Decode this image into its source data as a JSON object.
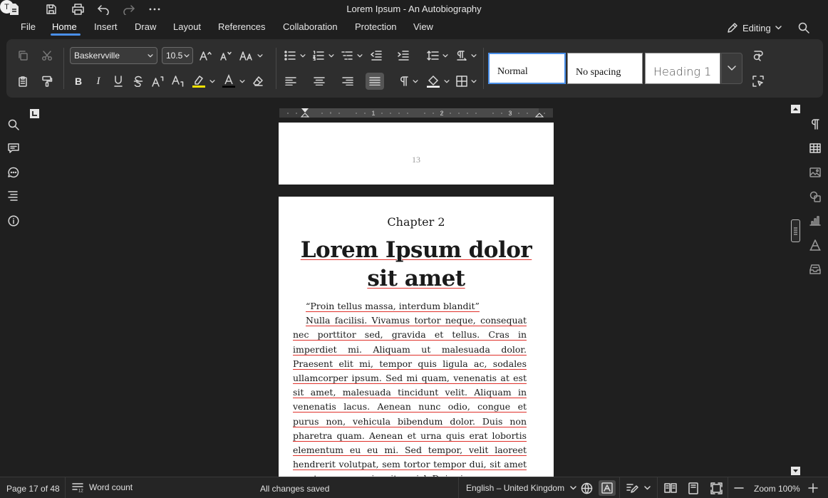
{
  "window": {
    "title": "Lorem Ipsum - An Autobiography",
    "user_initial": "T"
  },
  "menu": {
    "file": "File",
    "home": "Home",
    "insert": "Insert",
    "draw": "Draw",
    "layout": "Layout",
    "references": "References",
    "collaboration": "Collaboration",
    "protection": "Protection",
    "view": "View",
    "mode": "Editing"
  },
  "ribbon": {
    "font_family": "Baskervville",
    "font_size": "10.5",
    "styles": {
      "normal": "Normal",
      "no_spacing": "No spacing",
      "heading1": "Heading 1"
    },
    "colors": {
      "highlight": "#f5e100",
      "font_color": "#000000"
    }
  },
  "document": {
    "prev_page_number": "13",
    "chapter": "Chapter 2",
    "heading": "Lorem Ipsum dolor sit amet",
    "quote": "“Proin tellus massa, interdum blandit”",
    "paragraph": "Nulla facilisi. Vivamus tortor neque, consequat nec porttitor sed, gravida et tellus. Cras in imperdiet mi. Aliquam ut malesuada dolor. Praesent elit mi, tempor quis ligula ac, sodales ullamcorper ipsum. Sed mi quam, venenatis at est sit amet, malesuada tincidunt velit. Aliquam in venenatis lacus. Aenean nunc odio, congue et purus non, vehicula bibendum dolor. Duis non pharetra quam. Aenean et urna quis erat lobortis elementum eu eu mi. Sed tempor, velit laoreet hendrerit volutpat, sem tortor tempor dui, sit amet egestas neque enim vitae nisl. Duis viverra ac-"
  },
  "ruler": {
    "ticks": [
      "1",
      "2",
      "3"
    ]
  },
  "status": {
    "page": "Page 17 of 48",
    "word_count": "Word count",
    "save_state": "All changes saved",
    "language": "English – United Kingdom",
    "zoom": "Zoom 100%"
  }
}
